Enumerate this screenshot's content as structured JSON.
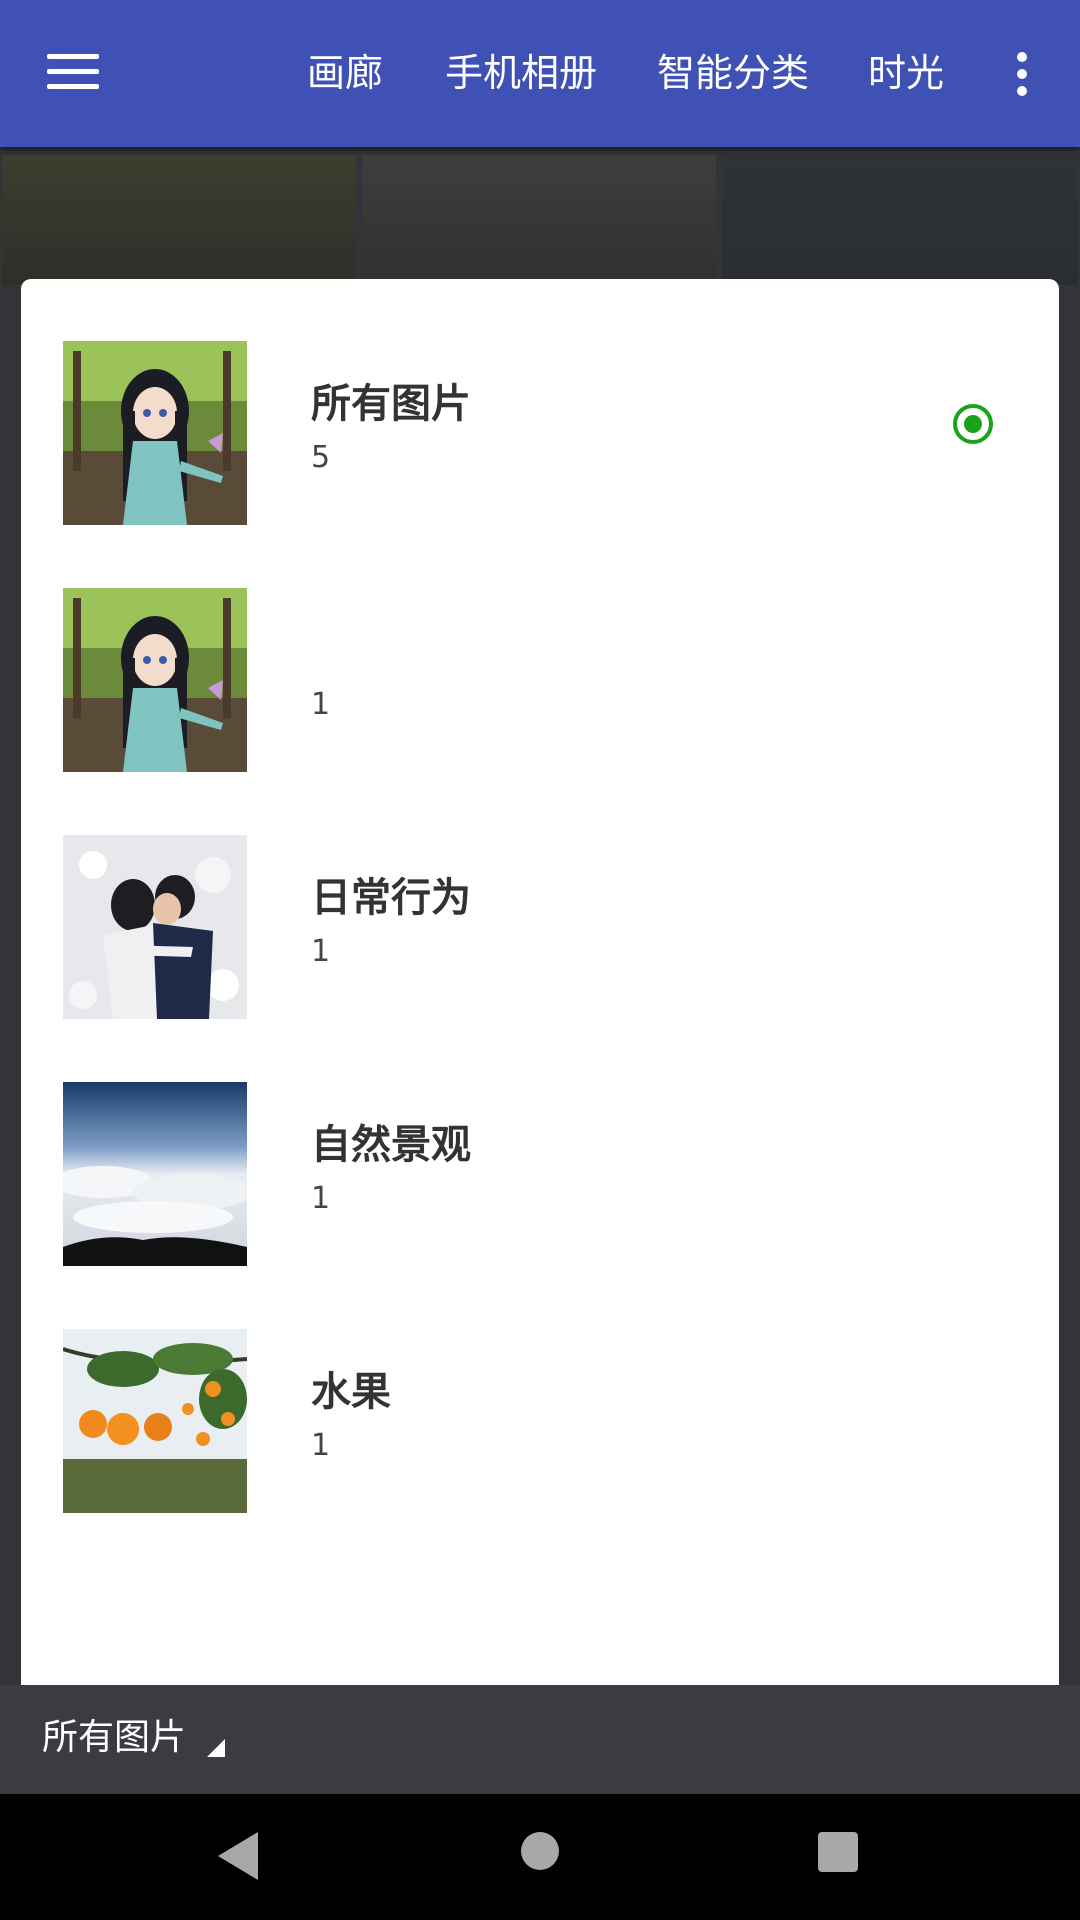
{
  "appbar": {
    "menu_icon": "hamburger-menu-icon",
    "tabs": [
      "画廊",
      "手机相册",
      "智能分类",
      "时光"
    ],
    "more_icon": "more-vert-icon",
    "color": "#3f51b5"
  },
  "albums": [
    {
      "title": "所有图片",
      "count": "5",
      "thumb": "anime-girl-thumbnail",
      "selected": true
    },
    {
      "title": "",
      "count": "1",
      "thumb": "anime-girl-thumbnail",
      "selected": false
    },
    {
      "title": "日常行为",
      "count": "1",
      "thumb": "couple-hug-thumbnail",
      "selected": false
    },
    {
      "title": "自然景观",
      "count": "1",
      "thumb": "sea-of-clouds-thumbnail",
      "selected": false
    },
    {
      "title": "水果",
      "count": "1",
      "thumb": "orange-tree-thumbnail",
      "selected": false
    }
  ],
  "selected_color": "#1aa31a",
  "bottom_bar": {
    "current_album": "所有图片",
    "dropdown_icon": "triangle-dropdown-icon"
  },
  "navbar": {
    "back_icon": "back-triangle-icon",
    "home_icon": "home-circle-icon",
    "recent_icon": "recent-apps-square-icon"
  }
}
